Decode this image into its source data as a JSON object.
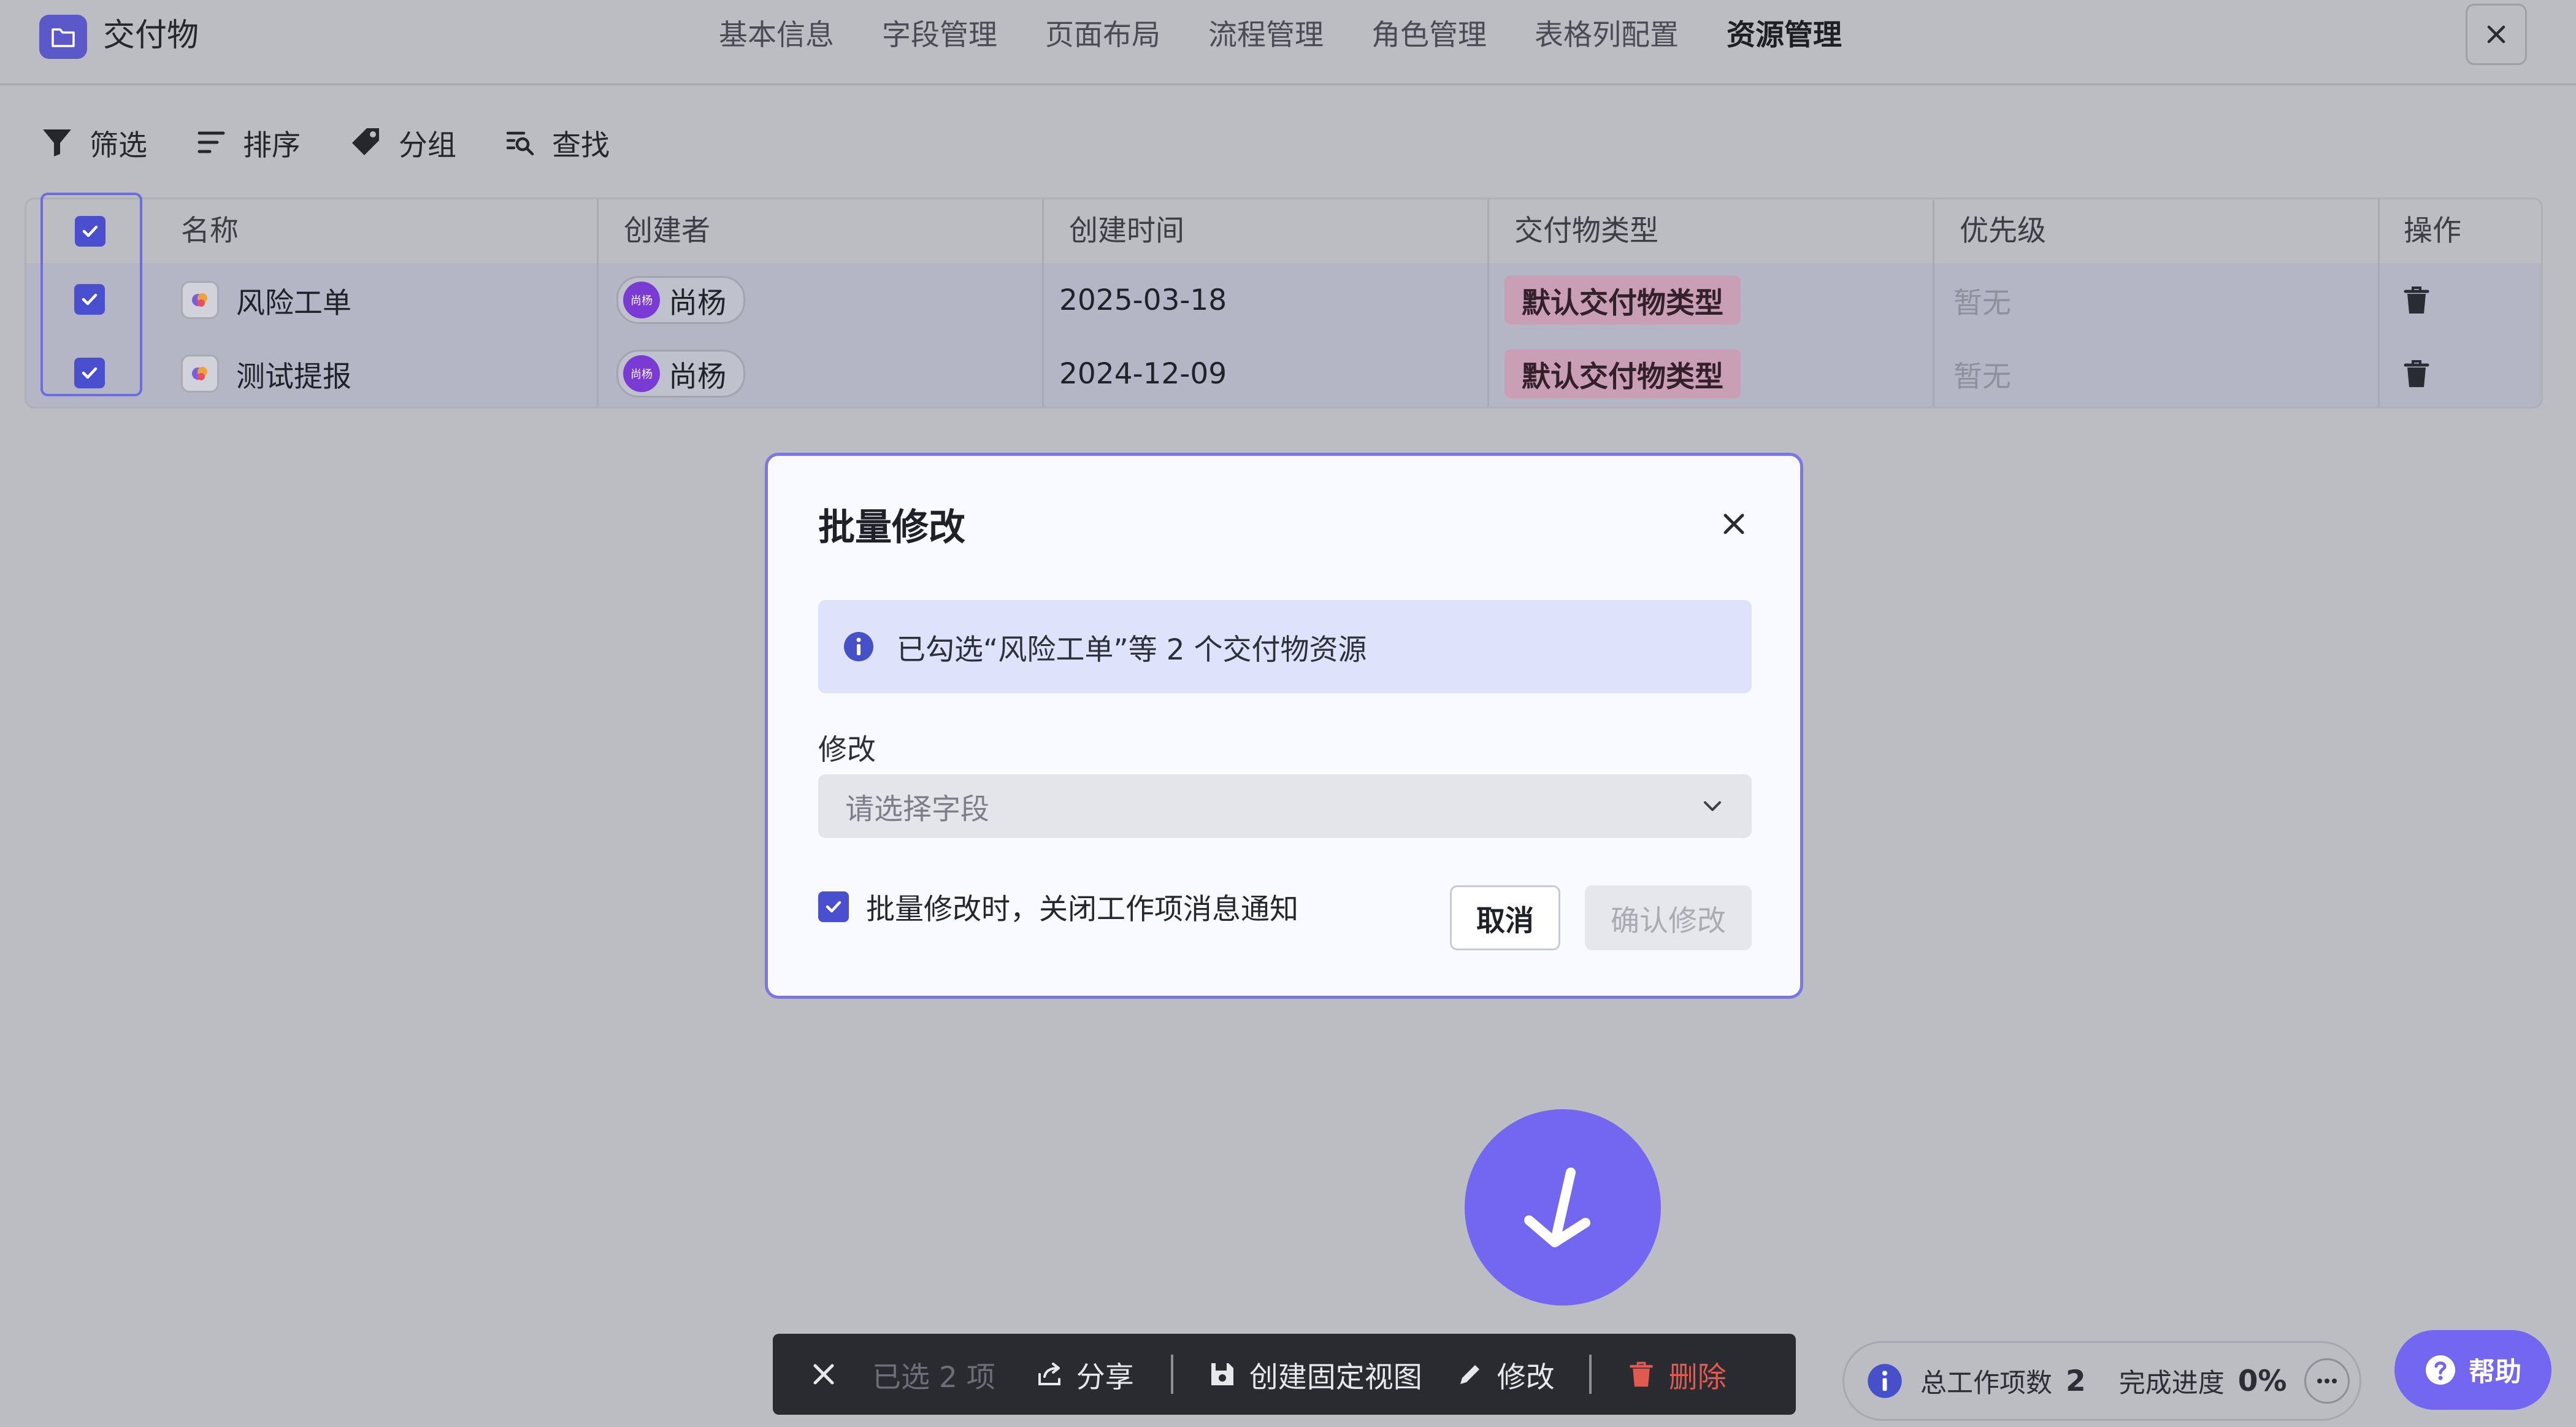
{
  "header": {
    "app_title": "交付物",
    "app_icon": "folder-icon",
    "tabs": [
      "基本信息",
      "字段管理",
      "页面布局",
      "流程管理",
      "角色管理",
      "表格列配置",
      "资源管理"
    ],
    "active_tab": "资源管理"
  },
  "toolbar": {
    "filter": "筛选",
    "sort": "排序",
    "group": "分组",
    "find": "查找"
  },
  "table": {
    "columns": [
      "名称",
      "创建者",
      "创建时间",
      "交付物类型",
      "优先级",
      "操作"
    ],
    "rows": [
      {
        "name": "风险工单",
        "creator": "尚杨",
        "creator_avatar": "尚杨",
        "created": "2025-03-18",
        "type": "默认交付物类型",
        "priority": "暂无",
        "checked": true
      },
      {
        "name": "测试提报",
        "creator": "尚杨",
        "creator_avatar": "尚杨",
        "created": "2024-12-09",
        "type": "默认交付物类型",
        "priority": "暂无",
        "checked": true
      }
    ]
  },
  "modal": {
    "title": "批量修改",
    "info": "已勾选“风险工单”等 2 个交付物资源",
    "field_label": "修改",
    "select_placeholder": "请选择字段",
    "notify_label": "批量修改时，关闭工作项消息通知",
    "cancel": "取消",
    "confirm": "确认修改"
  },
  "action_bar": {
    "selected": "已选 2 项",
    "share": "分享",
    "create_view": "创建固定视图",
    "edit": "修改",
    "delete": "删除"
  },
  "status": {
    "total_label": "总工作项数",
    "total_value": "2",
    "progress_label": "完成进度",
    "progress_value": "0%"
  },
  "help": {
    "label": "帮助"
  },
  "colors": {
    "accent": "#7366f0",
    "checkbox": "#4a4fd0",
    "danger": "#e15a4f",
    "tag_bg": "#c99fb6"
  }
}
